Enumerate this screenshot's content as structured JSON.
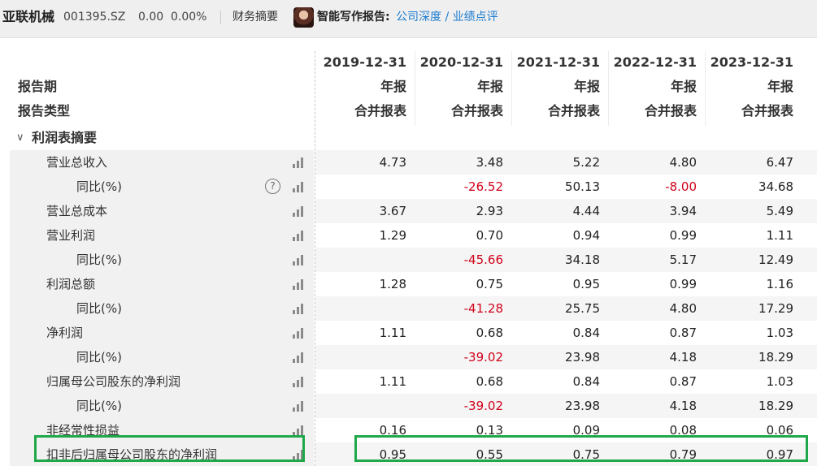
{
  "header": {
    "company": "亚联机械",
    "code": "001395.SZ",
    "price": "0.00",
    "change_pct": "0.00%",
    "financial_summary": "财务摘要",
    "ai_report_label": "智能写作报告:",
    "ai_report_links": "公司深度 / 业绩点评"
  },
  "table": {
    "period_label": "报告期",
    "type_label": "报告类型",
    "columns": [
      {
        "date": "2019-12-31",
        "period": "年报",
        "type": "合并报表"
      },
      {
        "date": "2020-12-31",
        "period": "年报",
        "type": "合并报表"
      },
      {
        "date": "2021-12-31",
        "period": "年报",
        "type": "合并报表"
      },
      {
        "date": "2022-12-31",
        "period": "年报",
        "type": "合并报表"
      },
      {
        "date": "2023-12-31",
        "period": "年报",
        "type": "合并报表"
      }
    ],
    "section_title": "利润表摘要",
    "rows": [
      {
        "label": "营业总收入",
        "values": [
          "4.73",
          "3.48",
          "5.22",
          "4.80",
          "6.47"
        ]
      },
      {
        "label": "同比(%)",
        "values": [
          "",
          "-26.52",
          "50.13",
          "-8.00",
          "34.68"
        ]
      },
      {
        "label": "营业总成本",
        "values": [
          "3.67",
          "2.93",
          "4.44",
          "3.94",
          "5.49"
        ]
      },
      {
        "label": "营业利润",
        "values": [
          "1.29",
          "0.70",
          "0.94",
          "0.99",
          "1.11"
        ]
      },
      {
        "label": "同比(%)",
        "values": [
          "",
          "-45.66",
          "34.18",
          "5.17",
          "12.49"
        ]
      },
      {
        "label": "利润总额",
        "values": [
          "1.28",
          "0.75",
          "0.95",
          "0.99",
          "1.16"
        ]
      },
      {
        "label": "同比(%)",
        "values": [
          "",
          "-41.28",
          "25.75",
          "4.80",
          "17.29"
        ]
      },
      {
        "label": "净利润",
        "values": [
          "1.11",
          "0.68",
          "0.84",
          "0.87",
          "1.03"
        ]
      },
      {
        "label": "同比(%)",
        "values": [
          "",
          "-39.02",
          "23.98",
          "4.18",
          "18.29"
        ]
      },
      {
        "label": "归属母公司股东的净利润",
        "values": [
          "1.11",
          "0.68",
          "0.84",
          "0.87",
          "1.03"
        ]
      },
      {
        "label": "同比(%)",
        "values": [
          "",
          "-39.02",
          "23.98",
          "4.18",
          "18.29"
        ]
      },
      {
        "label": "非经常性损益",
        "values": [
          "0.16",
          "0.13",
          "0.09",
          "0.08",
          "0.06"
        ]
      },
      {
        "label": "扣非后归属母公司股东的净利润",
        "values": [
          "0.95",
          "0.55",
          "0.75",
          "0.79",
          "0.97"
        ]
      }
    ]
  },
  "colors": {
    "negative": "#d0021b",
    "link": "#1a7bd0",
    "highlight": "#1fa84a"
  }
}
